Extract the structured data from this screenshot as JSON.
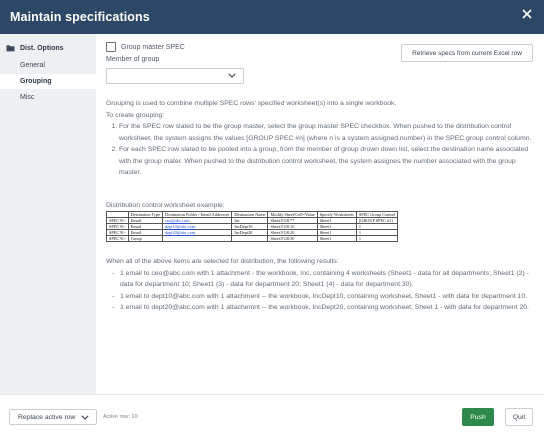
{
  "window": {
    "title": "Maintain specifications"
  },
  "sidebar": {
    "section_label": "Dist. Options",
    "items": [
      {
        "label": "General"
      },
      {
        "label": "Grouping"
      },
      {
        "label": "Misc"
      }
    ],
    "active_item": "Grouping"
  },
  "grouping": {
    "group_master_label": "Group master SPEC",
    "group_master_checked": false,
    "retrieve_button": "Retrieve specs from current Excel row",
    "member_label": "Member of group",
    "member_value": "",
    "intro": "Grouping is used to combine multiple SPEC rows' specified worksheet(s) into a single workbook.",
    "create_label": "To create grouping:",
    "steps": [
      "For the SPEC row slated to be the group master, select the group master SPEC checkbox. When pushed to the distribution control worksheet, the system assigns the values [GROUP SPEC #n] (where n is a system assigned number) in the SPEC group control column.",
      "For each SPEC row slated to be pooled into a group, from the member of group drown down list, select the destination name associated with the group mater. When pushed to the distribution control worksheet, the system assignes the number associated with the group master."
    ],
    "example_label": "Distribution control worksheet example:",
    "example_table": {
      "headers": [
        "",
        "Destination Type",
        "Destination Folder / Email Addresses",
        "Destination Name",
        "Modify Sheet!Cell=Value",
        "Specify Worksheets",
        "SPEC Group Control"
      ],
      "rows": [
        [
          "SPEC?0>",
          "Email",
          "ceo@abc.com",
          "Inc",
          "Sheet1!G8:**",
          "Sheet1",
          "[GROUP SPEC #1]"
        ],
        [
          "SPEC?0>",
          "Email",
          "dept10@abc.com",
          "IncDept10",
          "Sheet1!G8:10",
          "Sheet1",
          "1"
        ],
        [
          "SPEC?0>",
          "Email",
          "dept20@abc.com",
          "IncDept20",
          "Sheet1!G8:20",
          "Sheet1",
          "1"
        ],
        [
          "SPEC?0>",
          "Group",
          "",
          "",
          "Sheet1!G8:30",
          "Sheet1",
          "1"
        ]
      ]
    },
    "results_intro": "When all of the above items are selected for distribution, the following results:",
    "results": [
      "1 email to ceo@abc.com with 1 attachment - the workbook, Inc, containing 4 worksheets (Sheet1 - data for all departments; Sheet1 (2) - data for department 10; Sheet1 (3) - data for department 20; Sheet1 (4) - data for department 30).",
      "1 email to dept10@abc.com with 1 attachment -- the workbook, IncDept10, containing worksheet, Sheet1 - with data for department 10.",
      "1 email to dept20@abc.com with 1 attachemnt -- the workbook, IncDept20, containing worksheet, Sheet 1 - with data for department 20."
    ]
  },
  "footer": {
    "replace_select": "Replace active row",
    "active_row": "Active row: 10",
    "push_button": "Push",
    "quit_button": "Quit"
  },
  "colors": {
    "titlebar": "#2c4866",
    "push": "#2e8a4a",
    "sidebar_bg": "#eef1f4"
  }
}
